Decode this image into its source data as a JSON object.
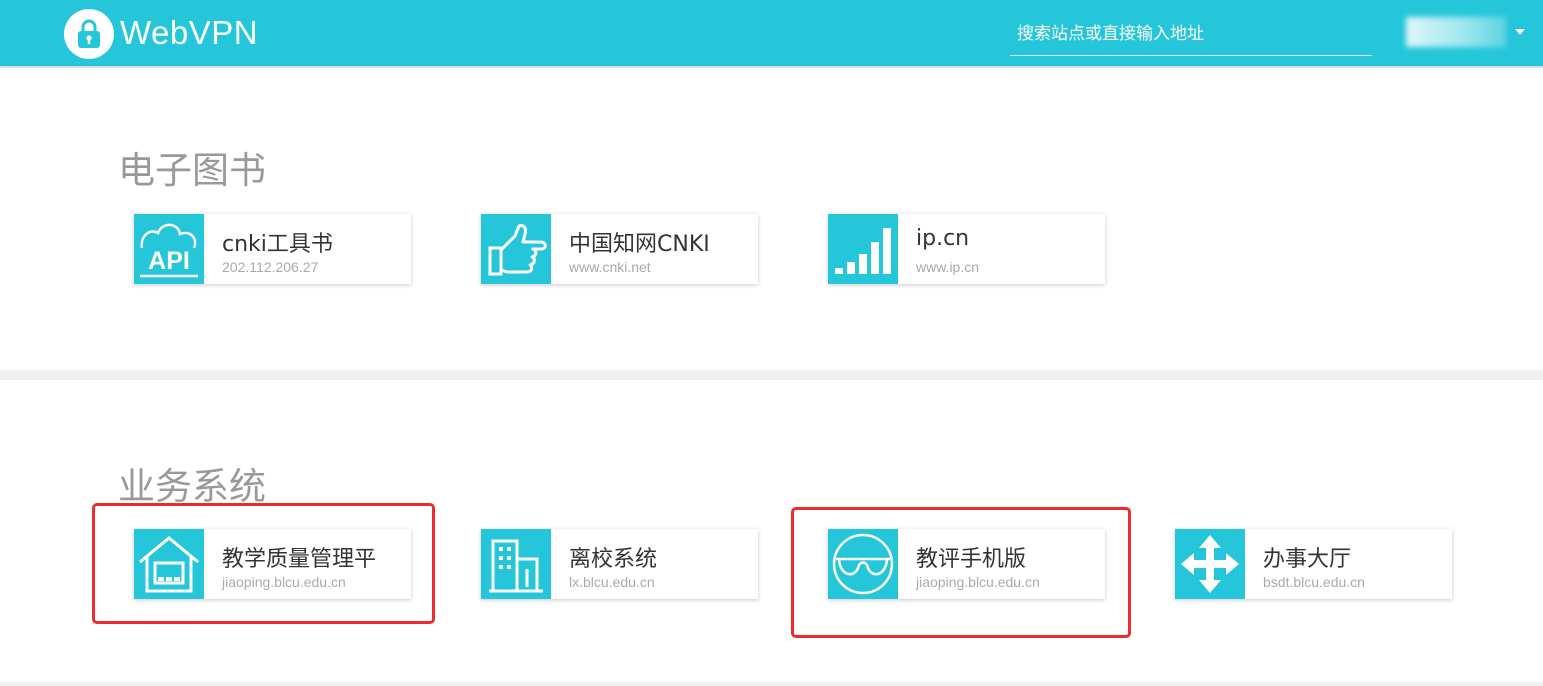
{
  "header": {
    "brand": "WebVPN",
    "search_placeholder": "搜索站点或直接输入地址",
    "colors": {
      "bar": "#26c6da",
      "text": "#ffffff"
    }
  },
  "sections": [
    {
      "title": "电子图书",
      "cards": [
        {
          "name": "cnki工具书",
          "host": "202.112.206.27",
          "icon": "api-cloud-icon"
        },
        {
          "name": "中国知网CNKI",
          "host": "www.cnki.net",
          "icon": "thumbs-up-hand-icon"
        },
        {
          "name": "ip.cn",
          "host": "www.ip.cn",
          "icon": "signal-bars-icon"
        }
      ]
    },
    {
      "title": "业务系统",
      "cards": [
        {
          "name": "教学质量管理平",
          "host": "jiaoping.blcu.edu.cn",
          "icon": "house-icon",
          "highlighted": true
        },
        {
          "name": "离校系统",
          "host": "lx.blcu.edu.cn",
          "icon": "building-icon"
        },
        {
          "name": "教评手机版",
          "host": "jiaoping.blcu.edu.cn",
          "icon": "glasses-icon",
          "highlighted": true
        },
        {
          "name": "办事大厅",
          "host": "bsdt.blcu.edu.cn",
          "icon": "move-arrows-icon"
        }
      ]
    }
  ],
  "highlight_color": "#ee2b2b"
}
